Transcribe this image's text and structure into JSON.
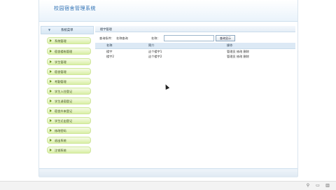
{
  "app": {
    "title": "校园宿舍管理系统"
  },
  "sidebar": {
    "header": "系统菜单",
    "items": [
      {
        "label": "系统管理"
      },
      {
        "label": "宿舍楼栋管理"
      },
      {
        "label": "学生管理"
      },
      {
        "label": "宿舍管理"
      },
      {
        "label": "考勤管理"
      },
      {
        "label": "学生入住登记"
      },
      {
        "label": "学生退宿登记"
      },
      {
        "label": "宿舍外来登记"
      },
      {
        "label": "学生迁出登记"
      },
      {
        "label": "修改密码"
      },
      {
        "label": "退出系统"
      },
      {
        "label": "注销系统"
      }
    ]
  },
  "content": {
    "section_title": "楼宇管理",
    "filter": {
      "label1": "查询条件：",
      "label1_value": "名称查询",
      "label2": "名称：",
      "input_value": "",
      "button_label": "查询显示"
    },
    "table": {
      "headers": [
        "名称",
        "简介",
        "操作"
      ],
      "rows": [
        {
          "name": "楼宇",
          "desc": "这个楼宇1",
          "actions": "管理员 修改 删除"
        },
        {
          "name": "楼宇2",
          "desc": "这个楼宇2",
          "actions": "管理员 修改 删除"
        }
      ]
    }
  },
  "taskbar": {
    "icons": [
      "pin-icon",
      "window-icon",
      "trash-icon"
    ]
  }
}
